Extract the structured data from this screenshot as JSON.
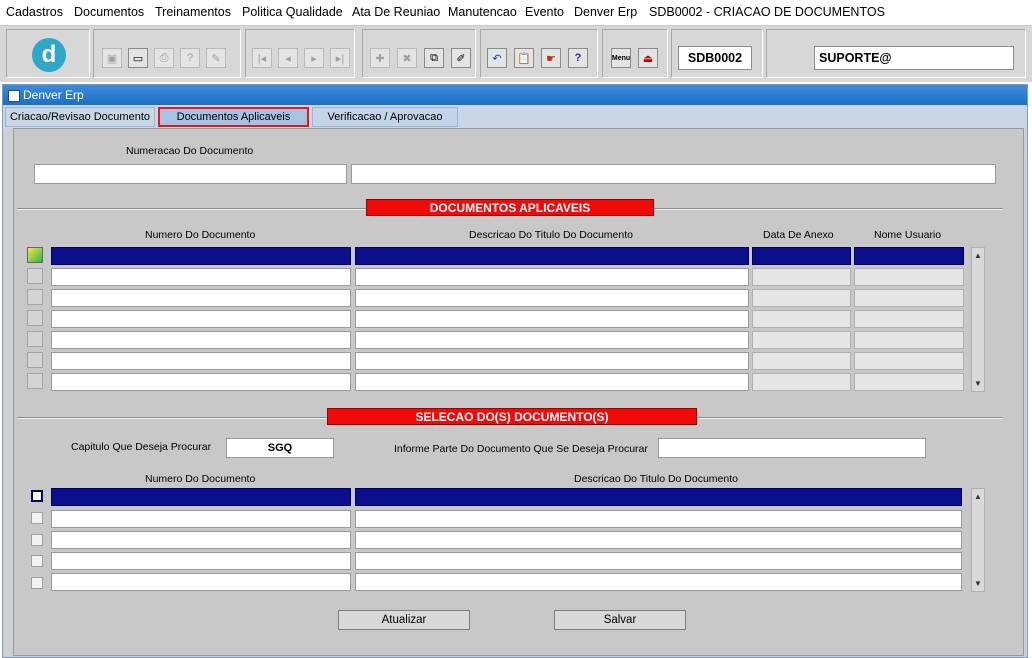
{
  "menu": [
    {
      "label": "Cadastros"
    },
    {
      "label": "Documentos"
    },
    {
      "label": "Treinamentos"
    },
    {
      "label": "Politica Qualidade"
    },
    {
      "label": "Ata De Reuniao"
    },
    {
      "label": "Manutencao"
    },
    {
      "label": "Evento"
    },
    {
      "label": "Denver Erp"
    },
    {
      "label": "SDB0002 - CRIACAO DE DOCUMENTOS"
    }
  ],
  "toolbar": {
    "form_code": "SDB0002",
    "user": "SUPORTE@",
    "logo_letter": "d",
    "menu_icon_label": "Menu"
  },
  "window": {
    "title": "Denver Erp"
  },
  "tabs": [
    {
      "label": "Criacao/Revisao Documento",
      "active": false
    },
    {
      "label": "Documentos Aplicaveis",
      "active": true
    },
    {
      "label": "Verificacao / Aprovacao",
      "active": false
    }
  ],
  "header": {
    "numeracao_label": "Numeracao Do Documento",
    "numeracao_value": "",
    "numeracao_desc": ""
  },
  "aplicaveis": {
    "banner": "DOCUMENTOS APLICAVEIS",
    "columns": [
      "Numero Do Documento",
      "Descricao Do Titulo Do Documento",
      "Data De Anexo",
      "Nome Usuario"
    ],
    "rows": [
      {
        "numero": "",
        "descricao": "",
        "data": "",
        "usuario": ""
      },
      {
        "numero": "",
        "descricao": "",
        "data": "",
        "usuario": ""
      },
      {
        "numero": "",
        "descricao": "",
        "data": "",
        "usuario": ""
      },
      {
        "numero": "",
        "descricao": "",
        "data": "",
        "usuario": ""
      },
      {
        "numero": "",
        "descricao": "",
        "data": "",
        "usuario": ""
      },
      {
        "numero": "",
        "descricao": "",
        "data": "",
        "usuario": ""
      },
      {
        "numero": "",
        "descricao": "",
        "data": "",
        "usuario": ""
      }
    ]
  },
  "selecao": {
    "banner": "SELECAO DO(S) DOCUMENTO(S)",
    "capitulo_label": "Capitulo Que Deseja Procurar",
    "capitulo_value": "SGQ",
    "parte_label": "Informe Parte Do Documento Que Se Deseja Procurar",
    "parte_value": "",
    "columns": [
      "Numero Do Documento",
      "Descricao Do Titulo Do Documento"
    ],
    "rows": [
      {
        "numero": "",
        "descricao": ""
      },
      {
        "numero": "",
        "descricao": ""
      },
      {
        "numero": "",
        "descricao": ""
      },
      {
        "numero": "",
        "descricao": ""
      },
      {
        "numero": "",
        "descricao": ""
      }
    ]
  },
  "buttons": {
    "atualizar": "Atualizar",
    "salvar": "Salvar"
  }
}
